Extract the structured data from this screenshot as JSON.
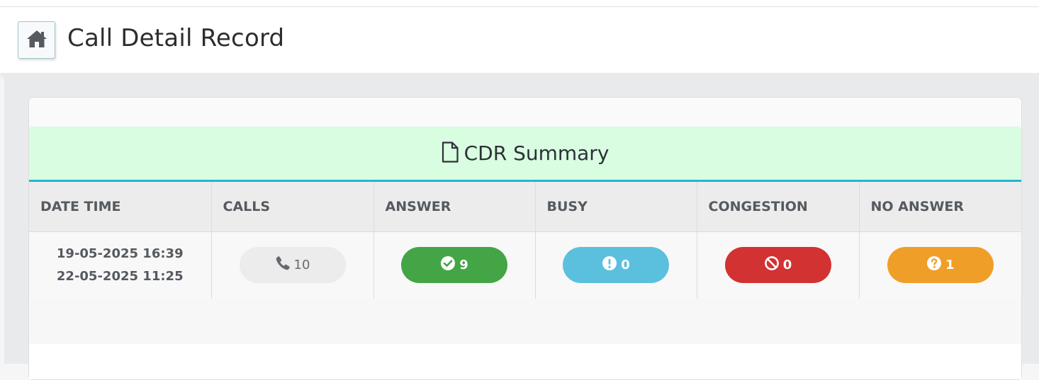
{
  "page": {
    "title": "Call Detail Record",
    "home_icon": "home-icon"
  },
  "summary": {
    "title": "CDR Summary",
    "title_icon": "document-icon",
    "columns": [
      "DATE TIME",
      "CALLS",
      "ANSWER",
      "BUSY",
      "CONGESTION",
      "NO ANSWER"
    ],
    "row": {
      "date_from": "19-05-2025 16:39",
      "date_to": "22-05-2025 11:25",
      "calls": "10",
      "answer": "9",
      "busy": "0",
      "congestion": "0",
      "no_answer": "1"
    }
  },
  "colors": {
    "header_bg": "#d9fde1",
    "header_border": "#22b5d6",
    "answer": "#43a546",
    "busy": "#5bc0de",
    "congestion": "#d33232",
    "no_answer": "#ef9e28",
    "calls": "#ececec"
  }
}
